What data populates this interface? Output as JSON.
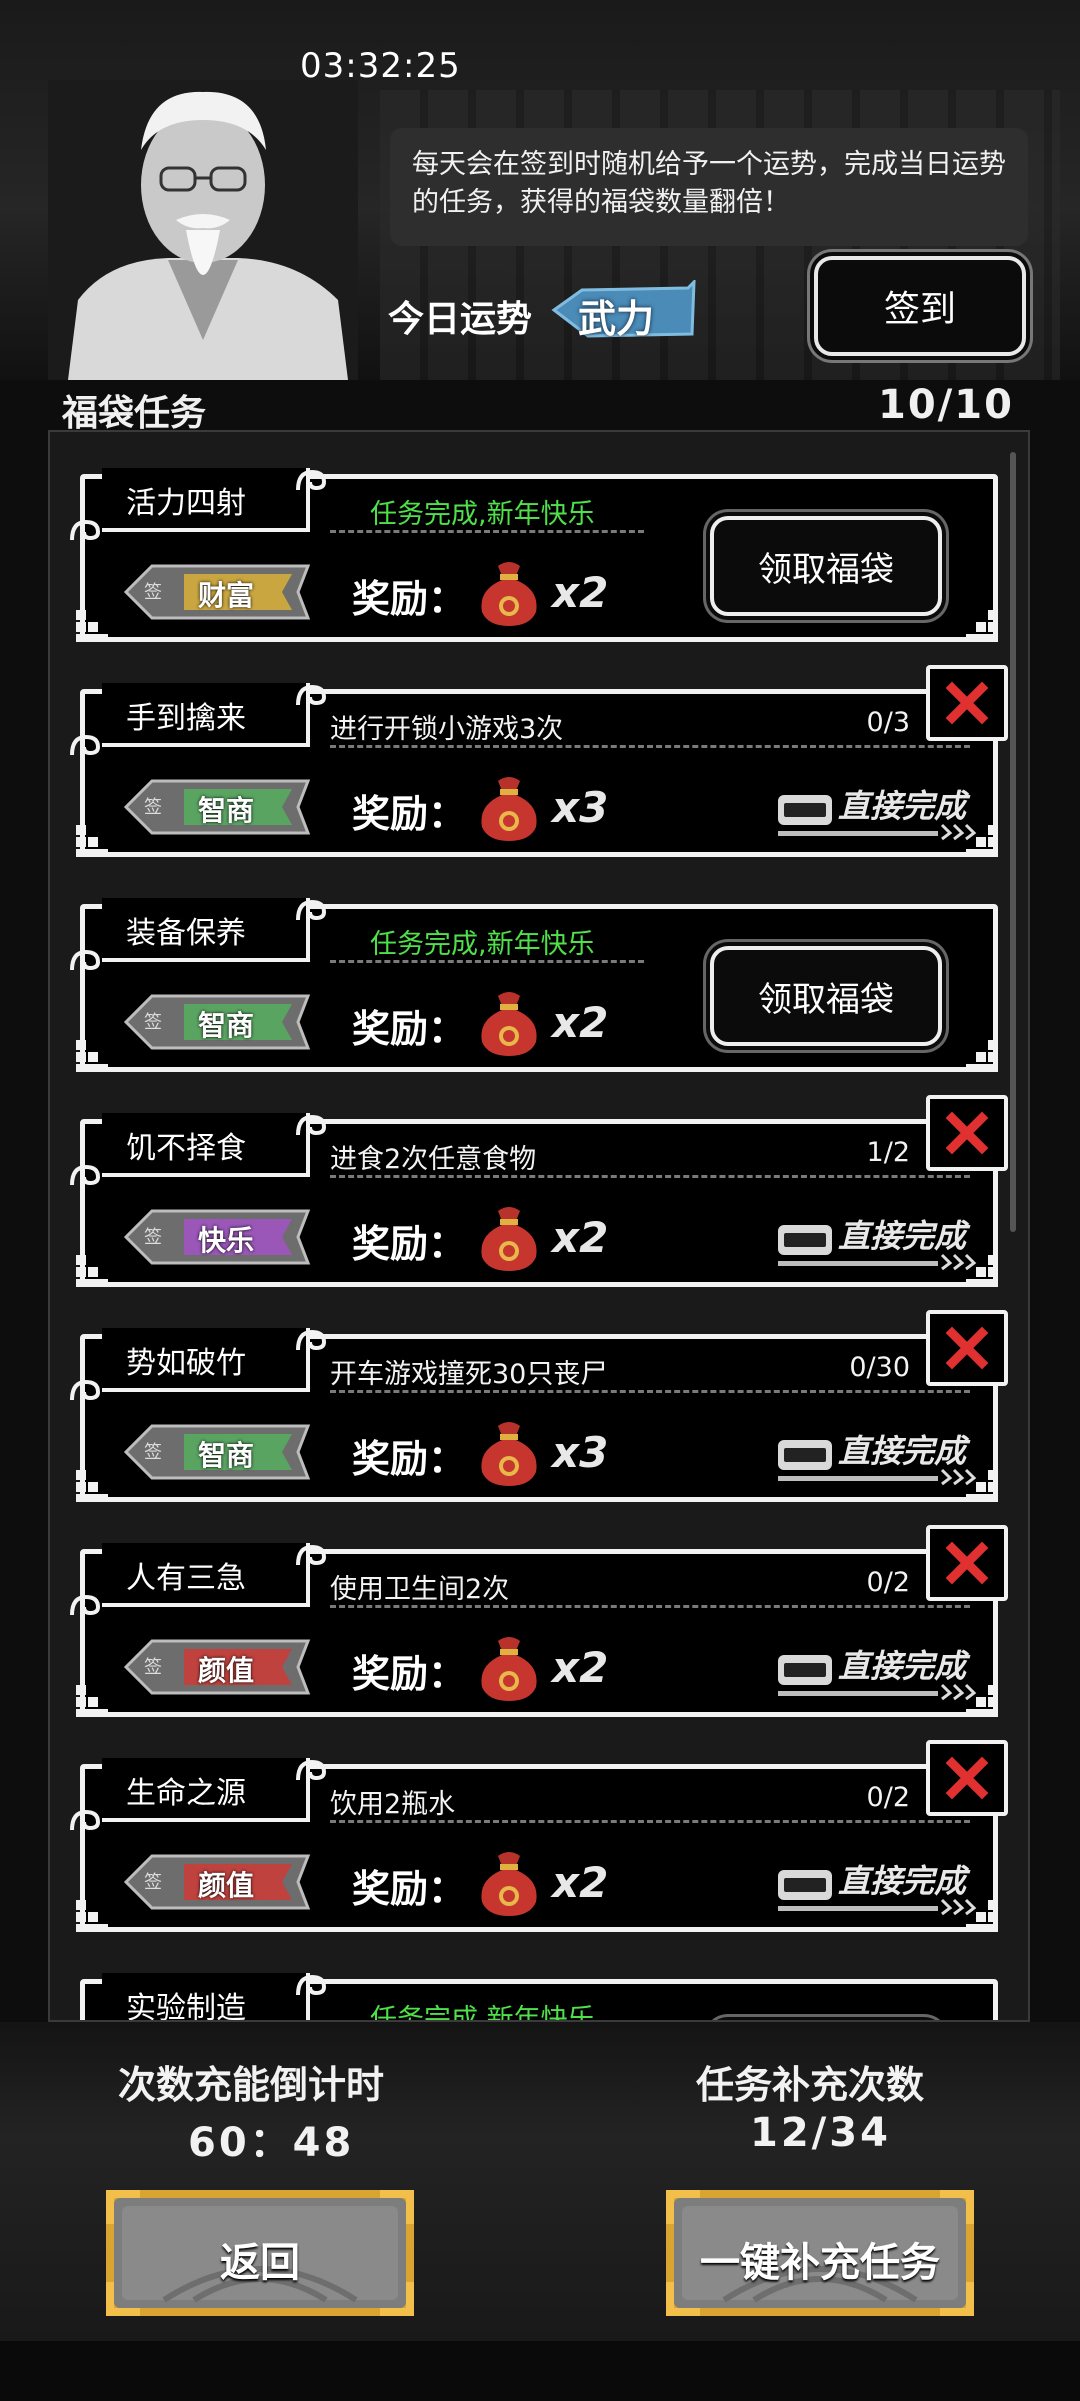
{
  "status_bar": {
    "time": "03:32:25"
  },
  "header": {
    "intro_text": "每天会在签到时随机给予一个运势，完成当日运势的任务，获得的福袋数量翻倍！",
    "fortune_label": "今日运势",
    "fortune_value": "武力",
    "sign_in_button": "签到"
  },
  "section": {
    "title": "福袋任务",
    "count": "10/10"
  },
  "common": {
    "reward_label": "奖励：",
    "claim_label": "领取福袋",
    "direct_complete_label": "直接完成",
    "sign_char": "签",
    "done_text": "任务完成,新年快乐"
  },
  "tasks": [
    {
      "name": "活力四射",
      "status": "done",
      "desc": "任务完成,新年快乐",
      "progress": "",
      "attribute": "财富",
      "attr_color": "#c9a640",
      "multiplier": "x2"
    },
    {
      "name": "手到擒来",
      "status": "open",
      "desc": "进行开锁小游戏3次",
      "progress": "0/3",
      "attribute": "智商",
      "attr_color": "#5aa462",
      "multiplier": "x3"
    },
    {
      "name": "装备保养",
      "status": "done",
      "desc": "任务完成,新年快乐",
      "progress": "",
      "attribute": "智商",
      "attr_color": "#5aa462",
      "multiplier": "x2"
    },
    {
      "name": "饥不择食",
      "status": "open",
      "desc": "进食2次任意食物",
      "progress": "1/2",
      "attribute": "快乐",
      "attr_color": "#9a57b8",
      "multiplier": "x2"
    },
    {
      "name": "势如破竹",
      "status": "open",
      "desc": "开车游戏撞死30只丧尸",
      "progress": "0/30",
      "attribute": "智商",
      "attr_color": "#5aa462",
      "multiplier": "x3"
    },
    {
      "name": "人有三急",
      "status": "open",
      "desc": "使用卫生间2次",
      "progress": "0/2",
      "attribute": "颜值",
      "attr_color": "#c0423e",
      "multiplier": "x2"
    },
    {
      "name": "生命之源",
      "status": "open",
      "desc": "饮用2瓶水",
      "progress": "0/2",
      "attribute": "颜值",
      "attr_color": "#c0423e",
      "multiplier": "x2"
    },
    {
      "name": "实验制造",
      "status": "done",
      "desc": "任务完成,新年快乐",
      "progress": "",
      "attribute": "",
      "attr_color": "",
      "multiplier": ""
    }
  ],
  "footer": {
    "recharge_label": "次数充能倒计时",
    "recharge_value": "60：48",
    "refill_label": "任务补充次数",
    "refill_value": "12/34",
    "back_button": "返回",
    "refill_button": "一键补充任务"
  },
  "colors": {
    "done_green": "#4fe04a",
    "close_red": "#e03030",
    "button_gold": "#d9a431"
  }
}
